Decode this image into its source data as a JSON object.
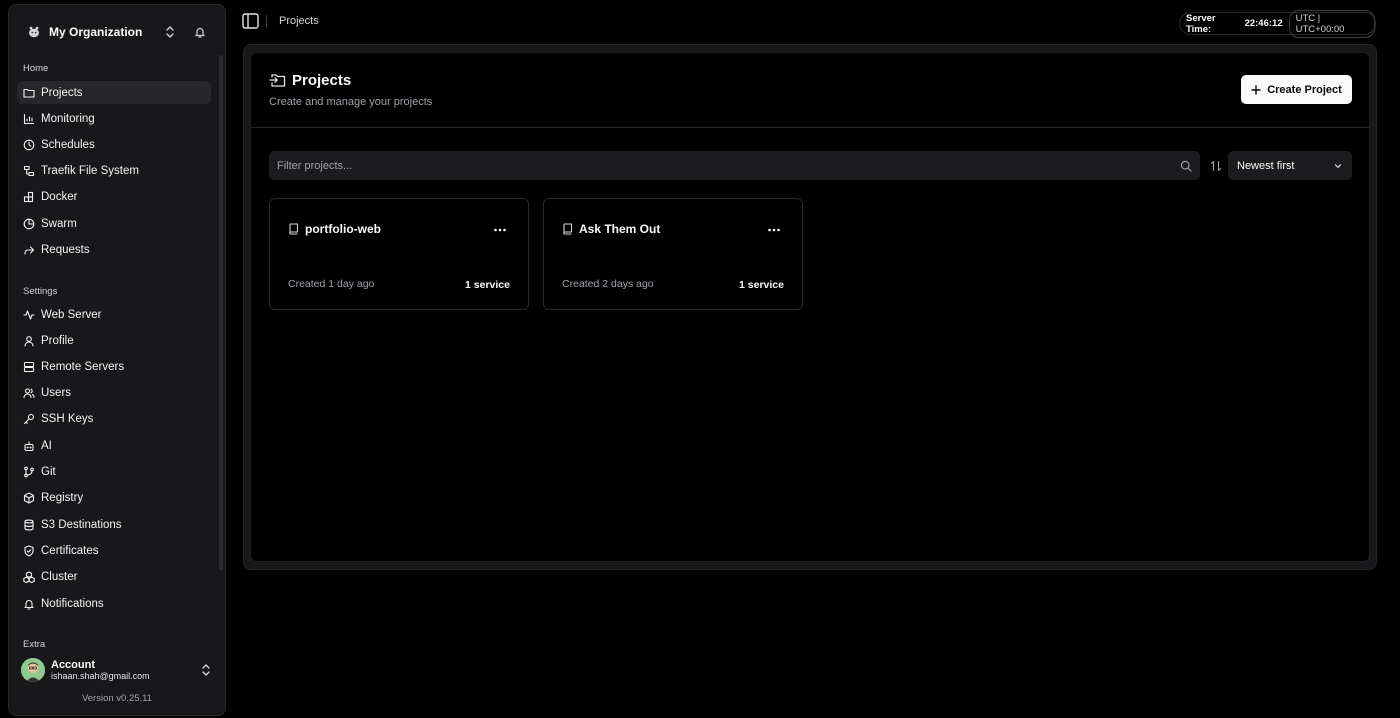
{
  "sidebar": {
    "org_name": "My Organization",
    "home_label": "Home",
    "home_items": [
      {
        "label": "Projects",
        "icon": "folder-icon",
        "active": true
      },
      {
        "label": "Monitoring",
        "icon": "chart-icon"
      },
      {
        "label": "Schedules",
        "icon": "clock-icon"
      },
      {
        "label": "Traefik File System",
        "icon": "file-system-icon"
      },
      {
        "label": "Docker",
        "icon": "docker-icon"
      },
      {
        "label": "Swarm",
        "icon": "pie-icon"
      },
      {
        "label": "Requests",
        "icon": "forward-icon"
      }
    ],
    "settings_label": "Settings",
    "settings_items": [
      {
        "label": "Web Server",
        "icon": "activity-icon"
      },
      {
        "label": "Profile",
        "icon": "user-icon"
      },
      {
        "label": "Remote Servers",
        "icon": "server-icon"
      },
      {
        "label": "Users",
        "icon": "users-icon"
      },
      {
        "label": "SSH Keys",
        "icon": "key-icon"
      },
      {
        "label": "AI",
        "icon": "bot-icon"
      },
      {
        "label": "Git",
        "icon": "git-branch-icon"
      },
      {
        "label": "Registry",
        "icon": "package-icon"
      },
      {
        "label": "S3 Destinations",
        "icon": "database-icon"
      },
      {
        "label": "Certificates",
        "icon": "shield-icon"
      },
      {
        "label": "Cluster",
        "icon": "boxes-icon"
      },
      {
        "label": "Notifications",
        "icon": "bell-icon"
      }
    ],
    "extra_label": "Extra",
    "account": {
      "name": "Account",
      "email": "ishaan.shah@gmail.com"
    },
    "version": "Version v0.25.11"
  },
  "topbar": {
    "breadcrumb": "Projects",
    "server_time_label": "Server Time:",
    "server_time": "22:46:12",
    "timezone": "UTC | UTC+00:00"
  },
  "page": {
    "title": "Projects",
    "subtitle": "Create and manage your projects",
    "create_button": "Create Project",
    "filter_placeholder": "Filter projects...",
    "sort_value": "Newest first"
  },
  "projects": [
    {
      "name": "portfolio-web",
      "created": "Created 1 day ago",
      "services": "1 service"
    },
    {
      "name": "Ask Them Out",
      "created": "Created 2 days ago",
      "services": "1 service"
    }
  ],
  "colors": {
    "background": "#000000",
    "sidebar": "#18181b",
    "primary_button": "#fafafa"
  }
}
